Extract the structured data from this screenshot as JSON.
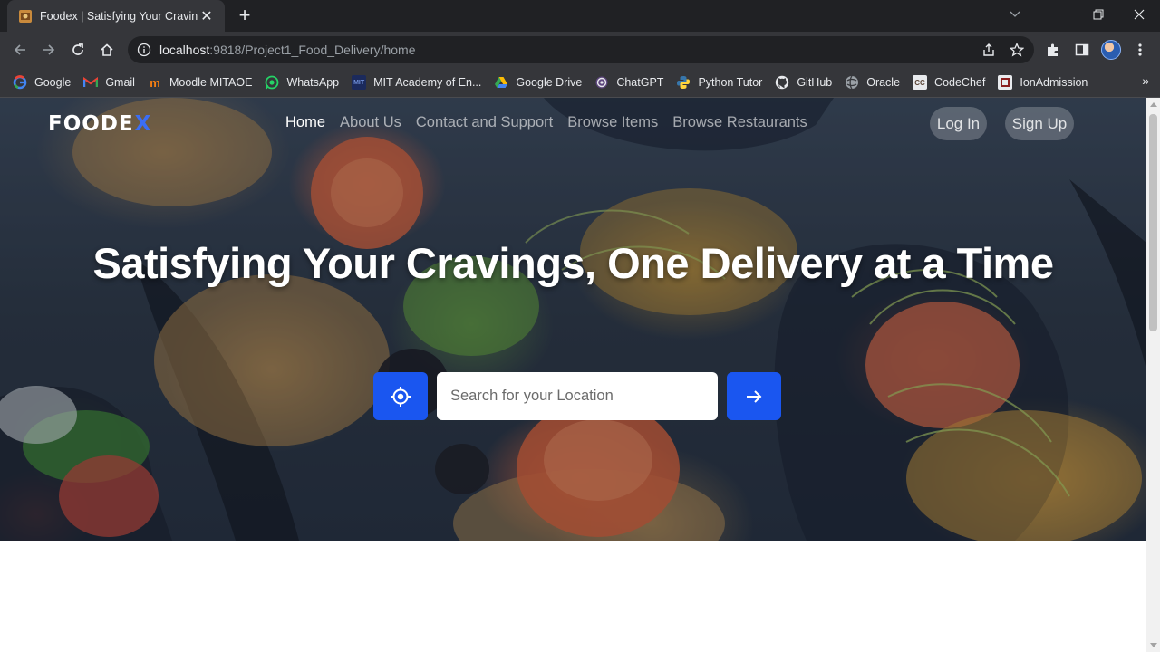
{
  "browser": {
    "tab_title": "Foodex | Satisfying Your Cravings",
    "url_host": "localhost",
    "url_rest": ":9818/Project1_Food_Delivery/home",
    "bookmarks": [
      {
        "label": "Google",
        "icon": "google-icon"
      },
      {
        "label": "Gmail",
        "icon": "gmail-icon"
      },
      {
        "label": "Moodle MITAOE",
        "icon": "moodle-icon"
      },
      {
        "label": "WhatsApp",
        "icon": "whatsapp-icon"
      },
      {
        "label": "MIT Academy of En...",
        "icon": "mit-icon"
      },
      {
        "label": "Google Drive",
        "icon": "google-drive-icon"
      },
      {
        "label": "ChatGPT",
        "icon": "chatgpt-icon"
      },
      {
        "label": "Python Tutor",
        "icon": "python-icon"
      },
      {
        "label": "GitHub",
        "icon": "github-icon"
      },
      {
        "label": "Oracle",
        "icon": "oracle-icon"
      },
      {
        "label": "CodeChef",
        "icon": "codechef-icon"
      },
      {
        "label": "IonAdmission",
        "icon": "ionadmission-icon"
      }
    ]
  },
  "site": {
    "logo_text": "FOODE",
    "logo_accent": "X",
    "nav": [
      {
        "label": "Home",
        "active": true
      },
      {
        "label": "About Us",
        "active": false
      },
      {
        "label": "Contact and Support",
        "active": false
      },
      {
        "label": "Browse Items",
        "active": false
      },
      {
        "label": "Browse Restaurants",
        "active": false
      }
    ],
    "login_label": "Log In",
    "signup_label": "Sign Up",
    "headline": "Satisfying Your Cravings, One Delivery at a Time",
    "search_placeholder": "Search for your Location",
    "accent_color": "#1a56f0"
  }
}
